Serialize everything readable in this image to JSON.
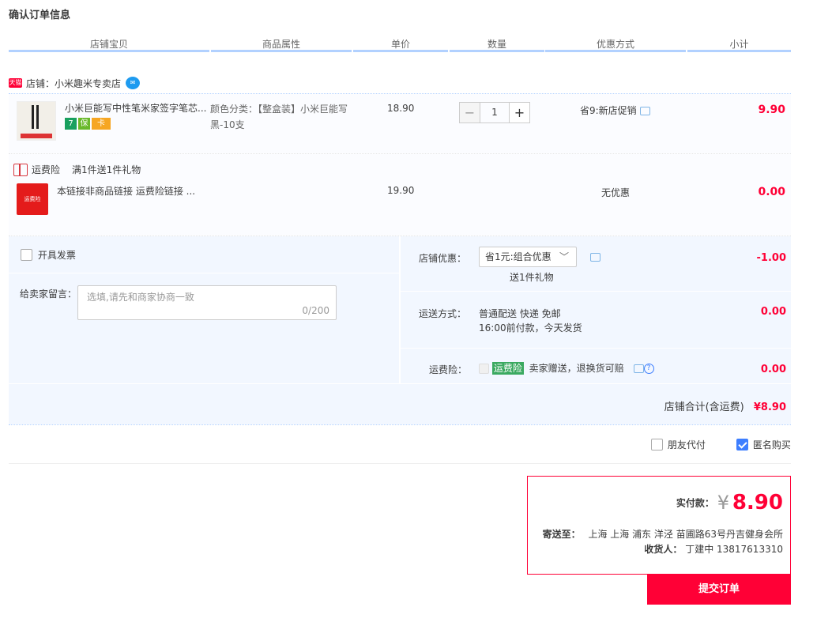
{
  "page": {
    "title": "确认订单信息"
  },
  "columns": [
    "店铺宝贝",
    "商品属性",
    "单价",
    "数量",
    "优惠方式",
    "小计"
  ],
  "shop": {
    "badge": "天猫",
    "label": "店铺：小米趣米专卖店"
  },
  "item": {
    "title": "小米巨能写中性笔米家签字笔芯...",
    "sku_label": "颜色分类：【整盒装】小米巨能写",
    "sku_value": "黑-10支",
    "unit_price": "18.90",
    "quantity": "1",
    "minus": "−",
    "plus": "+",
    "promotion": "省9:新店促销",
    "subtotal": "9.90",
    "tags": [
      "7",
      "保",
      "卡"
    ]
  },
  "gift": {
    "label": "运费险",
    "promo_text": "满1件送1件礼物",
    "title": "本链接非商品链接 运费险链接 ...",
    "unit_price": "19.90",
    "promotion": "无优惠",
    "subtotal": "0.00",
    "img_text": "运费险"
  },
  "invoice": {
    "label": "开具发票"
  },
  "message": {
    "label": "给卖家留言：",
    "placeholder": "选填,请先和商家协商一致",
    "counter": "0/200"
  },
  "shop_discount": {
    "label": "店铺优惠：",
    "selected": "省1元:组合优惠",
    "note": "送1件礼物",
    "amount": "-1.00"
  },
  "shipping": {
    "label": "运送方式：",
    "method": "普通配送 快递 免邮",
    "note": "16:00前付款，今天发货",
    "amount": "0.00"
  },
  "insurance": {
    "label": "运费险：",
    "tag": "运费险",
    "text": "卖家赠送，退换货可赔",
    "amount": "0.00"
  },
  "shop_total": {
    "label": "店铺合计(含运费)",
    "amount": "¥8.90"
  },
  "options": {
    "friend_pay": "朋友代付",
    "anonymous": "匿名购买"
  },
  "payment": {
    "label": "实付款：",
    "currency": "¥",
    "amount": "8.90",
    "ship_to_label": "寄送至：",
    "address": "上海 上海 浦东 洋泾 苗圃路63号丹吉健身会所",
    "receiver_label": "收货人：",
    "receiver": "丁建中 13817613310"
  },
  "submit": {
    "label": "提交订单"
  },
  "colors": {
    "accent": "#ff0036",
    "header_line": "#b2d1ff",
    "panel_bg": "#f2f7ff"
  }
}
